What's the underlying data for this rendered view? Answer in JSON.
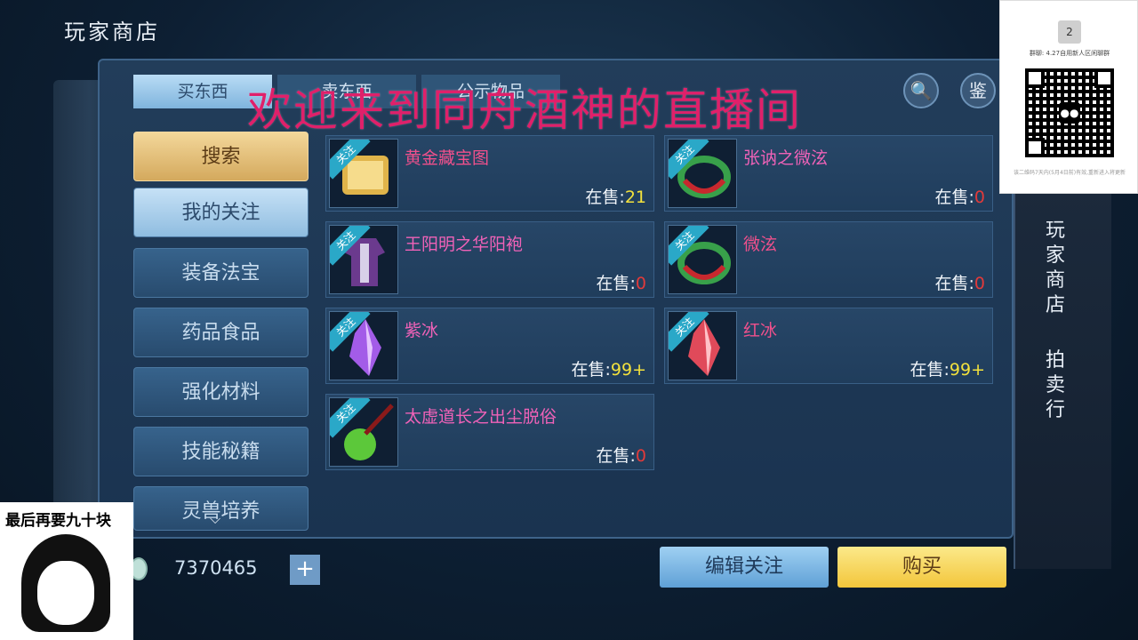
{
  "window": {
    "title": "玩家商店"
  },
  "tabs": [
    {
      "label": "买东西",
      "active": true
    },
    {
      "label": "卖东西",
      "active": false
    },
    {
      "label": "公示物品",
      "active": false
    }
  ],
  "top_buttons": {
    "search_icon": "magnifier-icon",
    "appraise_label": "鉴"
  },
  "overlay": {
    "watermark": "欢迎来到同舟酒神的直播间"
  },
  "sidebar": {
    "items": [
      {
        "label": "搜索"
      },
      {
        "label": "我的关注"
      },
      {
        "label": "装备法宝"
      },
      {
        "label": "药品食品"
      },
      {
        "label": "强化材料"
      },
      {
        "label": "技能秘籍"
      },
      {
        "label": "灵兽培养"
      }
    ]
  },
  "ribbon": "关注",
  "sale_prefix": "在售:",
  "items": [
    {
      "name": "黄金藏宝图",
      "count": "21"
    },
    {
      "name": "张讷之微泫",
      "count": "0"
    },
    {
      "name": "王阳明之华阳袍",
      "count": "0"
    },
    {
      "name": "微泫",
      "count": "0"
    },
    {
      "name": "紫冰",
      "count": "99+"
    },
    {
      "name": "红冰",
      "count": "99+"
    },
    {
      "name": "太虚道长之出尘脱俗",
      "count": "0"
    }
  ],
  "footer": {
    "currency": "7370465",
    "plus": "+",
    "edit_button": "编辑关注",
    "buy_button": "购买"
  },
  "right_side": {
    "shop_label": "玩家商店",
    "auction_label": "拍卖行"
  },
  "qr": {
    "avatar": "2",
    "text": "群聊: 4.27自用新人区闲聊群",
    "footer": "该二维码7天内(5月4日前)有效,重新进入将更新"
  },
  "meme": {
    "caption": "最后再要九十块"
  },
  "colors": {
    "accent_pink": "#f0508c",
    "count_yellow": "#f3e23d",
    "count_red": "#e23a3a",
    "buy_gold": "#f3c63b"
  }
}
